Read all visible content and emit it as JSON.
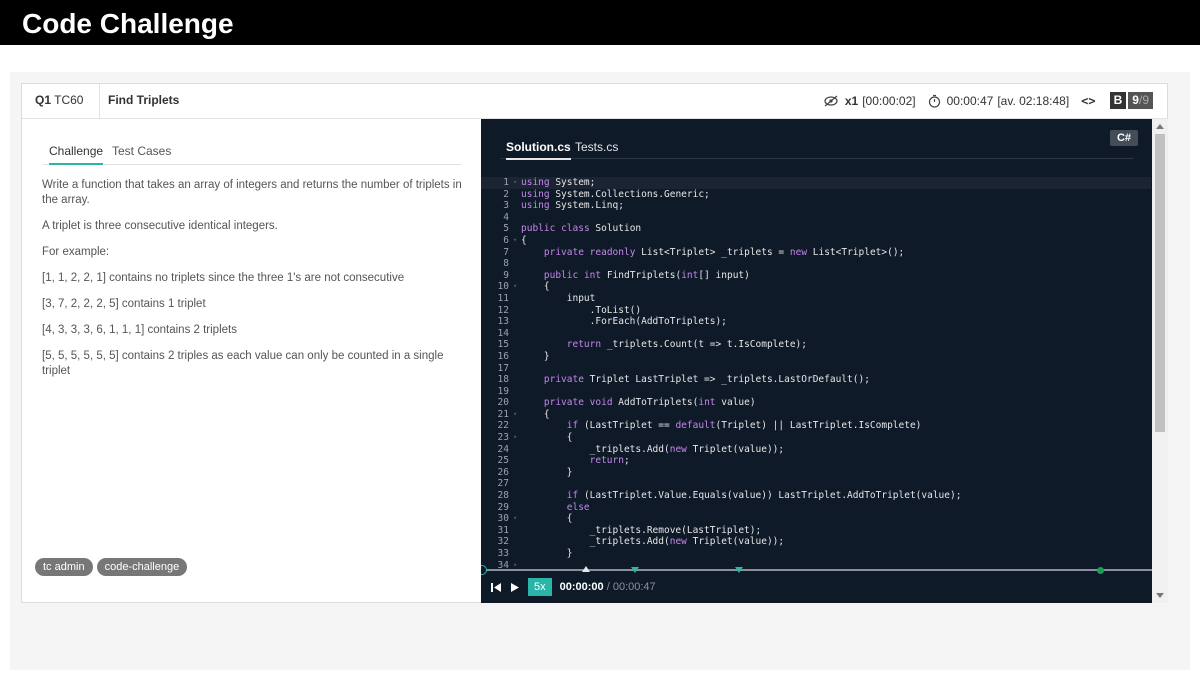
{
  "app": {
    "title": "Code Challenge"
  },
  "header": {
    "qnum": "Q1",
    "tc": "TC60",
    "name": "Find Triplets",
    "views": "x1",
    "views_time": "[00:00:02]",
    "time": "00:00:47",
    "avg": "[av. 02:18:48]",
    "code_icon": "<>",
    "grade": "B",
    "score": "9",
    "score_total": "/9"
  },
  "left": {
    "tabs": [
      "Challenge",
      "Test Cases"
    ],
    "paragraphs": [
      "Write a function that takes an array of integers and returns the number of triplets in the array.",
      "A triplet is three consecutive identical integers.",
      "For example:",
      "[1, 1, 2, 2, 1] contains no triplets since the three 1's are not consecutive",
      "[3, 7, 2, 2, 2, 5] contains 1 triplet",
      "[4, 3, 3, 3, 6, 1, 1, 1] contains 2 triplets",
      "[5, 5, 5, 5, 5, 5] contains 2 triples as each value can only be counted in a single triplet"
    ],
    "tags": [
      "tc admin",
      "code-challenge"
    ]
  },
  "editor": {
    "tabs": [
      "Solution.cs",
      "Tests.cs"
    ],
    "language": "C#",
    "lines": [
      "using System;",
      "using System.Collections.Generic;",
      "using System.Linq;",
      "",
      "public class Solution",
      "{",
      "    private readonly List<Triplet> _triplets = new List<Triplet>();",
      "",
      "    public int FindTriplets(int[] input)",
      "    {",
      "        input",
      "            .ToList()",
      "            .ForEach(AddToTriplets);",
      "",
      "        return _triplets.Count(t => t.IsComplete);",
      "    }",
      "",
      "    private Triplet LastTriplet => _triplets.LastOrDefault();",
      "",
      "    private void AddToTriplets(int value)",
      "    {",
      "        if (LastTriplet == default(Triplet) || LastTriplet.IsComplete)",
      "        {",
      "            _triplets.Add(new Triplet(value));",
      "            return;",
      "        }",
      "",
      "        if (LastTriplet.Value.Equals(value)) LastTriplet.AddToTriplet(value);",
      "        else",
      "        {",
      "            _triplets.Remove(LastTriplet);",
      "            _triplets.Add(new Triplet(value));",
      "        }",
      "        "
    ],
    "fold_lines": [
      1,
      6,
      10,
      21,
      23,
      30,
      34
    ]
  },
  "player": {
    "speed": "5x",
    "current": "00:00:00",
    "total": "/ 00:00:47",
    "colors": {
      "accent": "#2bb5a8",
      "marker_green": "#1a9e5a"
    }
  }
}
